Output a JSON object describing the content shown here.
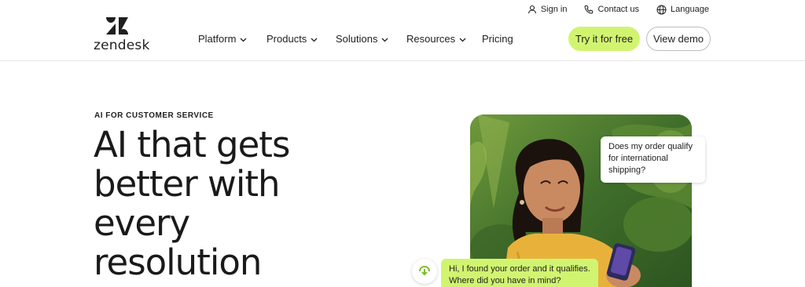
{
  "utility": {
    "sign_in": "Sign in",
    "contact_us": "Contact us",
    "language": "Language"
  },
  "logo": {
    "text": "zendesk",
    "icon": "zendesk-logo-icon"
  },
  "nav": {
    "items": [
      {
        "label": "Platform",
        "has_dropdown": true
      },
      {
        "label": "Products",
        "has_dropdown": true
      },
      {
        "label": "Solutions",
        "has_dropdown": true
      },
      {
        "label": "Resources",
        "has_dropdown": true
      },
      {
        "label": "Pricing",
        "has_dropdown": false
      }
    ]
  },
  "cta": {
    "try_label": "Try it for free",
    "demo_label": "View demo"
  },
  "hero": {
    "eyebrow": "AI FOR CUSTOMER SERVICE",
    "headline_lines": [
      "AI that gets",
      "better with",
      "every",
      "resolution"
    ]
  },
  "chat": {
    "question_lines": [
      "Does my order qualify",
      "for international",
      "shipping?"
    ],
    "answer_lines": [
      "Hi, I found your order and it qualifies.",
      "Where did you have in mind?"
    ],
    "agent_icon": "ai-agent-icon"
  },
  "colors": {
    "accent": "#d1f470",
    "text": "#1f1f1f",
    "border": "#bdbdbd"
  }
}
